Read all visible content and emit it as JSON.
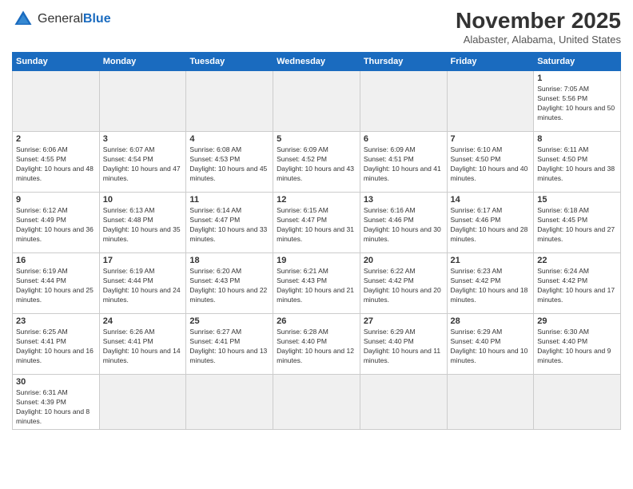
{
  "logo": {
    "text_general": "General",
    "text_blue": "Blue"
  },
  "title": "November 2025",
  "location": "Alabaster, Alabama, United States",
  "days_of_week": [
    "Sunday",
    "Monday",
    "Tuesday",
    "Wednesday",
    "Thursday",
    "Friday",
    "Saturday"
  ],
  "weeks": [
    [
      {
        "day": "",
        "empty": true
      },
      {
        "day": "",
        "empty": true
      },
      {
        "day": "",
        "empty": true
      },
      {
        "day": "",
        "empty": true
      },
      {
        "day": "",
        "empty": true
      },
      {
        "day": "",
        "empty": true
      },
      {
        "day": "1",
        "sunrise": "7:05 AM",
        "sunset": "5:56 PM",
        "daylight": "10 hours and 50 minutes."
      }
    ],
    [
      {
        "day": "2",
        "sunrise": "6:06 AM",
        "sunset": "4:55 PM",
        "daylight": "10 hours and 48 minutes."
      },
      {
        "day": "3",
        "sunrise": "6:07 AM",
        "sunset": "4:54 PM",
        "daylight": "10 hours and 47 minutes."
      },
      {
        "day": "4",
        "sunrise": "6:08 AM",
        "sunset": "4:53 PM",
        "daylight": "10 hours and 45 minutes."
      },
      {
        "day": "5",
        "sunrise": "6:09 AM",
        "sunset": "4:52 PM",
        "daylight": "10 hours and 43 minutes."
      },
      {
        "day": "6",
        "sunrise": "6:09 AM",
        "sunset": "4:51 PM",
        "daylight": "10 hours and 41 minutes."
      },
      {
        "day": "7",
        "sunrise": "6:10 AM",
        "sunset": "4:50 PM",
        "daylight": "10 hours and 40 minutes."
      },
      {
        "day": "8",
        "sunrise": "6:11 AM",
        "sunset": "4:50 PM",
        "daylight": "10 hours and 38 minutes."
      }
    ],
    [
      {
        "day": "9",
        "sunrise": "6:12 AM",
        "sunset": "4:49 PM",
        "daylight": "10 hours and 36 minutes."
      },
      {
        "day": "10",
        "sunrise": "6:13 AM",
        "sunset": "4:48 PM",
        "daylight": "10 hours and 35 minutes."
      },
      {
        "day": "11",
        "sunrise": "6:14 AM",
        "sunset": "4:47 PM",
        "daylight": "10 hours and 33 minutes."
      },
      {
        "day": "12",
        "sunrise": "6:15 AM",
        "sunset": "4:47 PM",
        "daylight": "10 hours and 31 minutes."
      },
      {
        "day": "13",
        "sunrise": "6:16 AM",
        "sunset": "4:46 PM",
        "daylight": "10 hours and 30 minutes."
      },
      {
        "day": "14",
        "sunrise": "6:17 AM",
        "sunset": "4:46 PM",
        "daylight": "10 hours and 28 minutes."
      },
      {
        "day": "15",
        "sunrise": "6:18 AM",
        "sunset": "4:45 PM",
        "daylight": "10 hours and 27 minutes."
      }
    ],
    [
      {
        "day": "16",
        "sunrise": "6:19 AM",
        "sunset": "4:44 PM",
        "daylight": "10 hours and 25 minutes."
      },
      {
        "day": "17",
        "sunrise": "6:19 AM",
        "sunset": "4:44 PM",
        "daylight": "10 hours and 24 minutes."
      },
      {
        "day": "18",
        "sunrise": "6:20 AM",
        "sunset": "4:43 PM",
        "daylight": "10 hours and 22 minutes."
      },
      {
        "day": "19",
        "sunrise": "6:21 AM",
        "sunset": "4:43 PM",
        "daylight": "10 hours and 21 minutes."
      },
      {
        "day": "20",
        "sunrise": "6:22 AM",
        "sunset": "4:42 PM",
        "daylight": "10 hours and 20 minutes."
      },
      {
        "day": "21",
        "sunrise": "6:23 AM",
        "sunset": "4:42 PM",
        "daylight": "10 hours and 18 minutes."
      },
      {
        "day": "22",
        "sunrise": "6:24 AM",
        "sunset": "4:42 PM",
        "daylight": "10 hours and 17 minutes."
      }
    ],
    [
      {
        "day": "23",
        "sunrise": "6:25 AM",
        "sunset": "4:41 PM",
        "daylight": "10 hours and 16 minutes."
      },
      {
        "day": "24",
        "sunrise": "6:26 AM",
        "sunset": "4:41 PM",
        "daylight": "10 hours and 14 minutes."
      },
      {
        "day": "25",
        "sunrise": "6:27 AM",
        "sunset": "4:41 PM",
        "daylight": "10 hours and 13 minutes."
      },
      {
        "day": "26",
        "sunrise": "6:28 AM",
        "sunset": "4:40 PM",
        "daylight": "10 hours and 12 minutes."
      },
      {
        "day": "27",
        "sunrise": "6:29 AM",
        "sunset": "4:40 PM",
        "daylight": "10 hours and 11 minutes."
      },
      {
        "day": "28",
        "sunrise": "6:29 AM",
        "sunset": "4:40 PM",
        "daylight": "10 hours and 10 minutes."
      },
      {
        "day": "29",
        "sunrise": "6:30 AM",
        "sunset": "4:40 PM",
        "daylight": "10 hours and 9 minutes."
      }
    ],
    [
      {
        "day": "30",
        "sunrise": "6:31 AM",
        "sunset": "4:39 PM",
        "daylight": "10 hours and 8 minutes."
      },
      {
        "day": "",
        "empty": true
      },
      {
        "day": "",
        "empty": true
      },
      {
        "day": "",
        "empty": true
      },
      {
        "day": "",
        "empty": true
      },
      {
        "day": "",
        "empty": true
      },
      {
        "day": "",
        "empty": true
      }
    ]
  ]
}
